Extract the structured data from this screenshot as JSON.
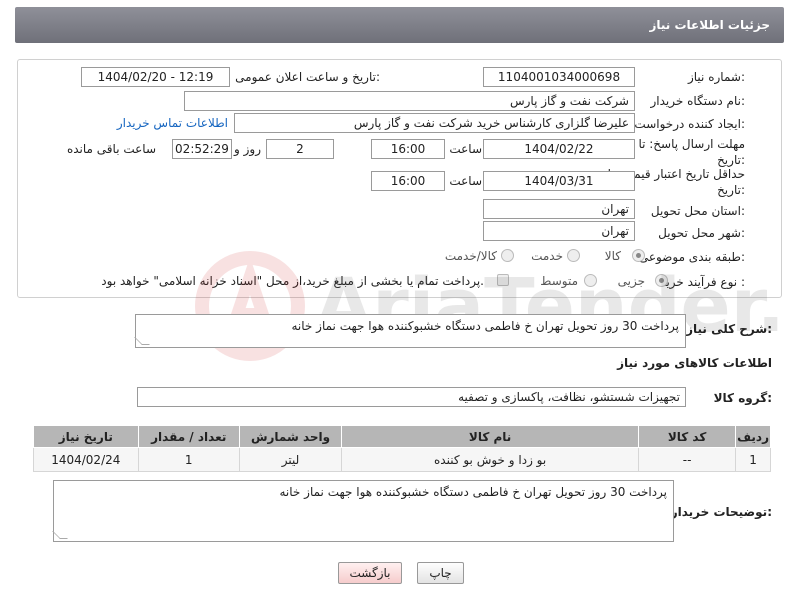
{
  "header": {
    "title": "جزئیات اطلاعات نیاز"
  },
  "form": {
    "need_number_label": "شماره نیاز:",
    "need_number": "1104001034000698",
    "announce_label": "تاریخ و ساعت اعلان عمومی:",
    "announce_value": "1404/02/20 - 12:19",
    "buyer_org_label": "نام دستگاه خریدار:",
    "buyer_org": "شرکت نفت و گاز پارس",
    "creator_label": "ایجاد کننده درخواست:",
    "creator": "علیرضا  گلزاری کارشناس خرید  شرکت نفت و گاز پارس",
    "contact_link": "اطلاعات تماس خریدار",
    "deadline_label": "مهلت ارسال پاسخ: تا تاریخ:",
    "deadline_date": "1404/02/22",
    "time_label": "ساعت",
    "deadline_time": "16:00",
    "days_value": "2",
    "days_label": "روز و",
    "remaining_time": "02:52:29",
    "remaining_label": "ساعت باقی مانده",
    "validity_label": "حداقل تاریخ اعتبار قیمت: تا تاریخ:",
    "validity_date": "1404/03/31",
    "validity_time": "16:00",
    "province_label": "استان محل تحویل:",
    "province": "تهران",
    "city_label": "شهر محل تحویل:",
    "city": "تهران",
    "category_label": "طبقه بندی موضوعی:",
    "category_options": [
      "کالا",
      "خدمت",
      "کالا/خدمت"
    ],
    "process_label": "نوع فرآیند خرید :",
    "process_options": [
      "جزیی",
      "متوسط"
    ],
    "payment_note": "پرداخت تمام یا بخشی از مبلغ خرید،از محل \"اسناد خزانه اسلامی\" خواهد بود."
  },
  "summary": {
    "label": "شرح کلی نیاز:",
    "text": "پرداخت 30 روز تحویل تهران خ فاطمی دستگاه خشبوکننده هوا جهت نماز خانه"
  },
  "goods": {
    "section_title": "اطلاعات کالاهای مورد نیاز",
    "group_label": "گروه کالا:",
    "group_value": "تجهیزات شستشو، نظافت، پاکسازی و تصفیه",
    "columns": [
      "ردیف",
      "کد کالا",
      "نام کالا",
      "واحد شمارش",
      "تعداد / مقدار",
      "تاریخ نیاز"
    ],
    "rows": [
      [
        "1",
        "--",
        "بو زدا و خوش بو کننده",
        "لیتر",
        "1",
        "1404/02/24"
      ]
    ]
  },
  "buyer_notes": {
    "label": "توضیحات خریدار:",
    "text": "پرداخت 30 روز تحویل تهران خ فاطمی دستگاه خشبوکننده هوا جهت نماز خانه"
  },
  "buttons": {
    "print": "چاپ",
    "back": "بازگشت"
  },
  "watermark": {
    "text": "AriaTender.net"
  },
  "colors": {
    "header_bg": "#7f8089",
    "link": "#1565c0",
    "back_button": "#f6cccc"
  }
}
